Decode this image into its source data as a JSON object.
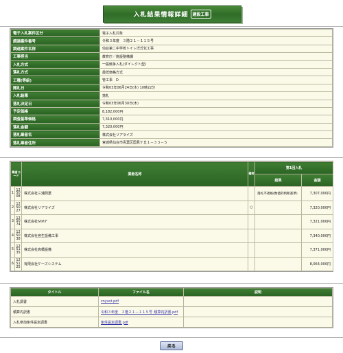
{
  "title": "入札結果情報詳細",
  "title_tag": "建設工事",
  "info": [
    {
      "label": "電子入札案件区分",
      "value": "電子入札対象"
    },
    {
      "label": "調達案件番号",
      "value": "令和３年度　３階２１－１１５号"
    },
    {
      "label": "調達案件名称",
      "value": "仙台第二中学校トイレ洋式化工事"
    },
    {
      "label": "工事担当",
      "value": "教育庁／施設整備課"
    },
    {
      "label": "入札方式",
      "value": "一般競争入札(ダイレクト型)"
    },
    {
      "label": "落札方式",
      "value": "最低価格方式"
    },
    {
      "label": "工種(等級)",
      "value": "管工事　D"
    },
    {
      "label": "開札日",
      "value": "令和03年06月24日(木) 10時22分"
    },
    {
      "label": "入札結果",
      "value": "落札"
    },
    {
      "label": "落札決定日",
      "value": "令和03年06月30日(木)"
    },
    {
      "label": "予定価格",
      "value": "8,182,000円"
    },
    {
      "label": "調査基準価格",
      "value": "7,310,000円"
    },
    {
      "label": "落札金額",
      "value": "7,320,000円"
    },
    {
      "label": "落札業者名",
      "value": "株式会社リアライズ"
    },
    {
      "label": "落札業者住所",
      "value": "宮城県仙台市青葉区国見ケ丘１－３３－５"
    }
  ],
  "bids_header": {
    "no": "業者コード",
    "name": "業者名称",
    "note": "備考",
    "round": "第1回入札",
    "result": "結果",
    "amount": "金額"
  },
  "bids": [
    {
      "idx": "1",
      "code": [
        "12",
        "50",
        "08"
      ],
      "name": "株式会社三浦興業",
      "note": "",
      "result": "落札不適格(数値的判断基準)",
      "amount": "7,307,000円"
    },
    {
      "idx": "2",
      "code": [
        "12",
        "50",
        "27"
      ],
      "name": "株式会社リアライズ",
      "note": "○",
      "result": "",
      "amount": "7,320,000円"
    },
    {
      "idx": "3",
      "code": [
        "12",
        "50",
        "74"
      ],
      "name": "株式会社ＭＭＦ",
      "note": "",
      "result": "",
      "amount": "7,321,000円"
    },
    {
      "idx": "4",
      "code": [
        "12",
        "50",
        "38"
      ],
      "name": "株式会社宮生設備工事",
      "note": "",
      "result": "",
      "amount": "7,340,000円"
    },
    {
      "idx": "5",
      "code": [
        "12",
        "51",
        "35"
      ],
      "name": "株式会社高橋設備",
      "note": "",
      "result": "",
      "amount": "7,371,000円"
    },
    {
      "idx": "6",
      "code": [
        "12",
        "51",
        "25"
      ],
      "name": "有限会社ケーズシステム",
      "note": "",
      "result": "",
      "amount": "8,064,000円"
    }
  ],
  "files_header": {
    "title": "タイトル",
    "file": "ファイル名",
    "desc": "説明"
  },
  "files": [
    {
      "title": "入札調書",
      "file": "znyust.pdf",
      "desc": ""
    },
    {
      "title": "積算内訳書",
      "file": "令和３年度　３階２１－１１５号_積算内訳書.pdf",
      "desc": ""
    },
    {
      "title": "入札参加条件設定調書",
      "file": "条件設定調書.pdf",
      "desc": ""
    }
  ],
  "back_label": "戻る"
}
